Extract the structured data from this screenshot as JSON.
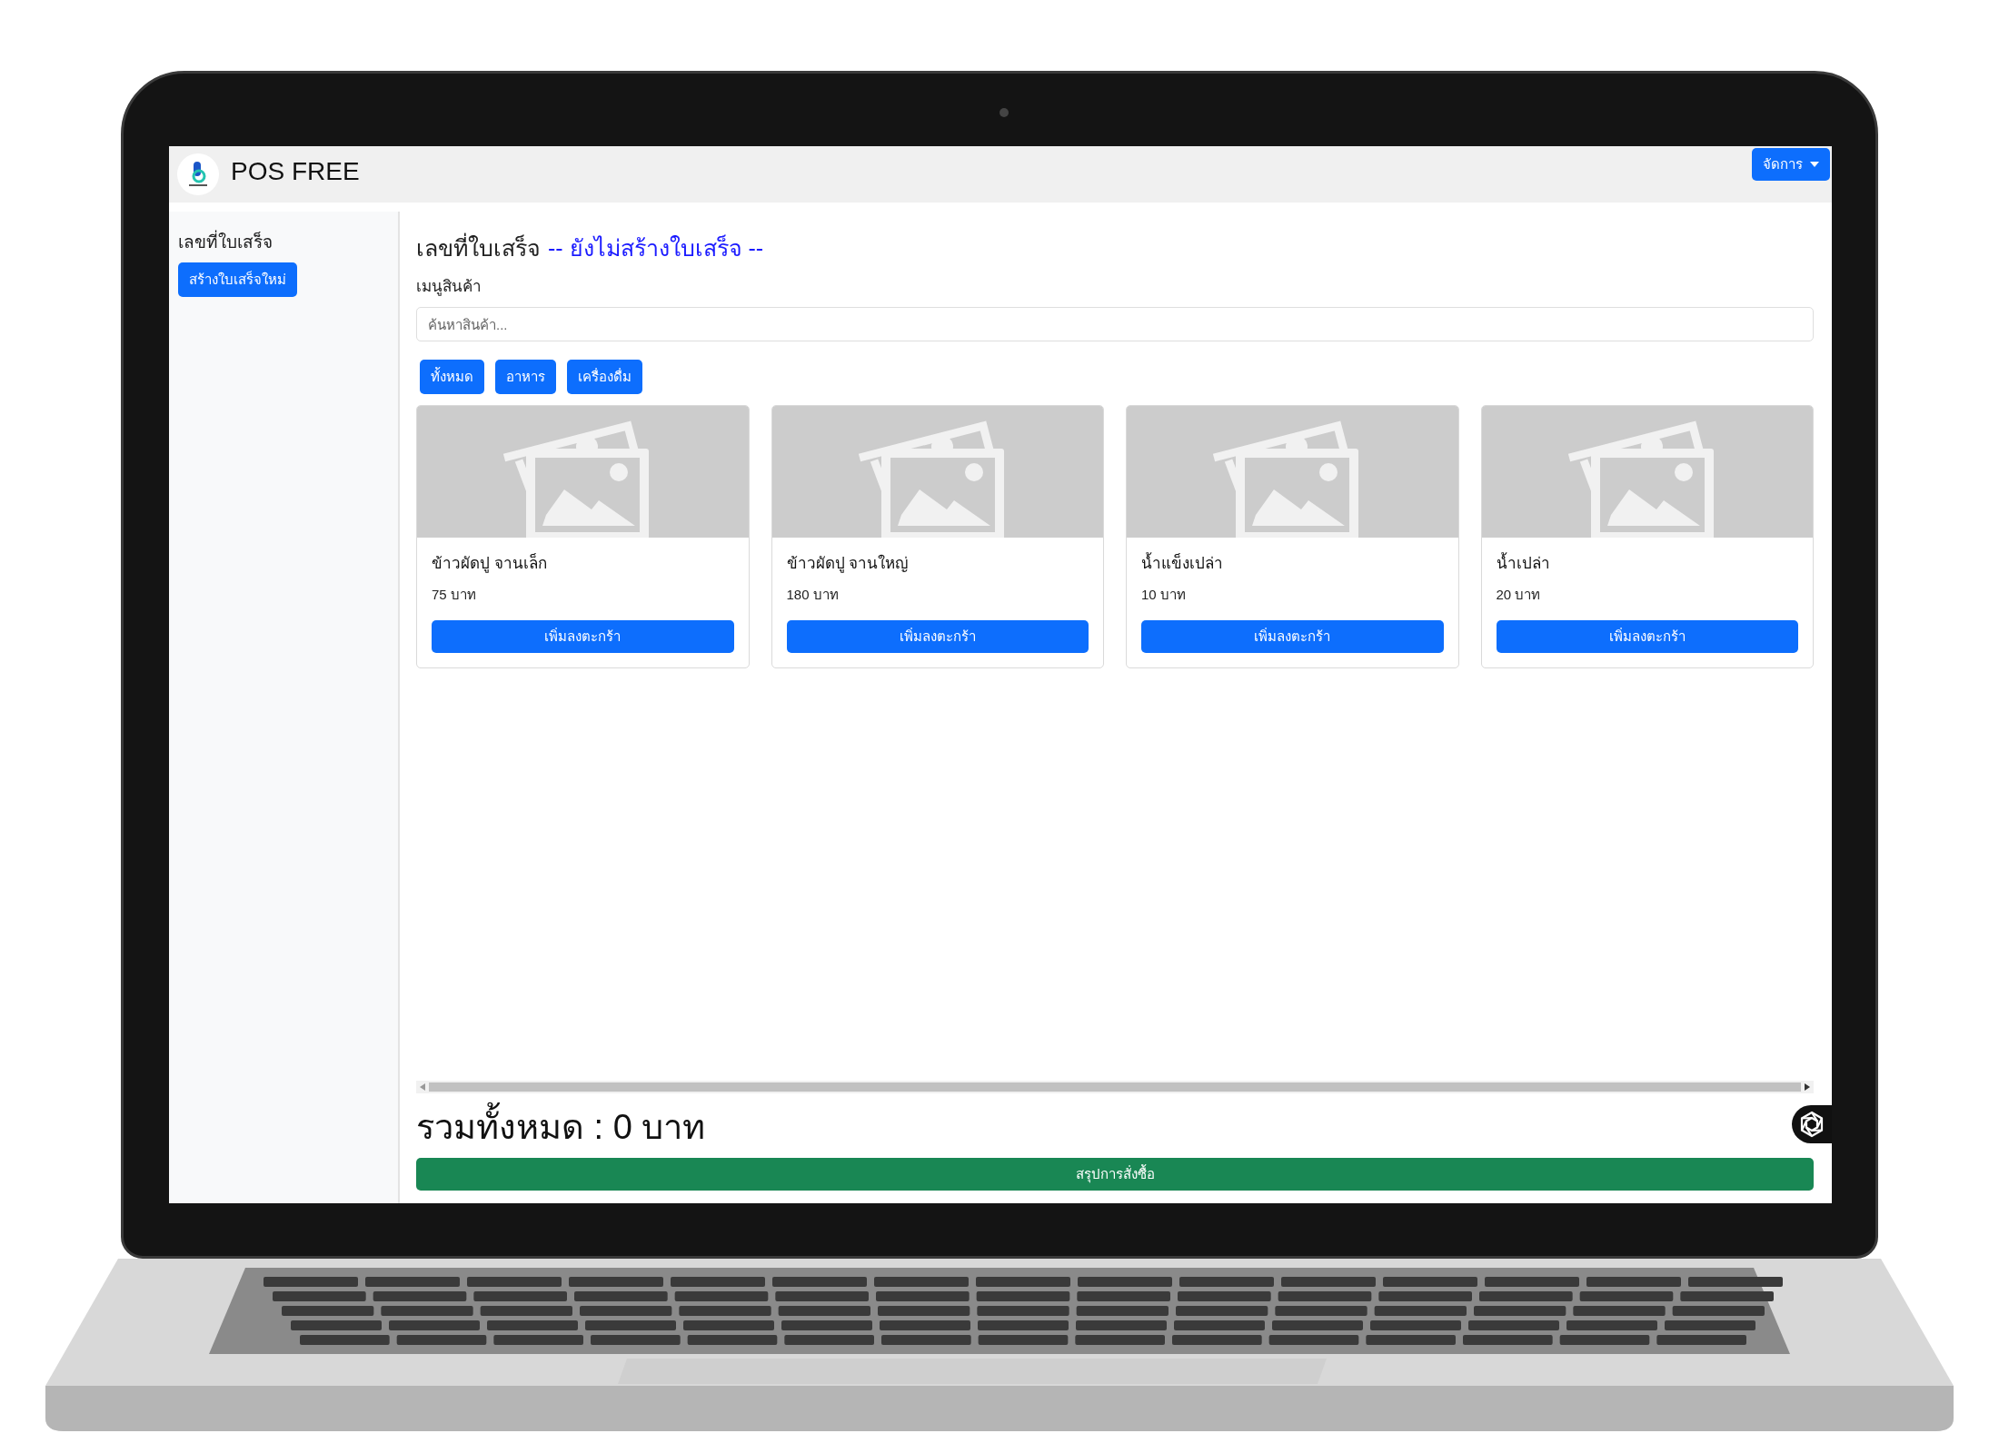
{
  "header": {
    "title": "POS FREE",
    "menu_button": "จัดการ"
  },
  "sidebar": {
    "label": "เลขที่ใบเสร็จ",
    "button": "สร้างใบเสร็จใหม่"
  },
  "receipt": {
    "label": "เลขที่ใบเสร็จ",
    "status": "-- ยังไม่สร้างใบเสร็จ --"
  },
  "menu_label": "เมนูสินค้า",
  "search": {
    "placeholder": "ค้นหาสินค้า..."
  },
  "categories": [
    {
      "label": "ทั้งหมด"
    },
    {
      "label": "อาหาร"
    },
    {
      "label": "เครื่องดื่ม"
    }
  ],
  "products": [
    {
      "name": "ข้าวผัดปู จานเล็ก",
      "price": "75 บาท",
      "button": "เพิ่มลงตะกร้า"
    },
    {
      "name": "ข้าวผัดปู จานใหญ่",
      "price": "180 บาท",
      "button": "เพิ่มลงตะกร้า"
    },
    {
      "name": "น้ำแข็งเปล่า",
      "price": "10 บาท",
      "button": "เพิ่มลงตะกร้า"
    },
    {
      "name": "น้ำเปล่า",
      "price": "20 บาท",
      "button": "เพิ่มลงตะกร้า"
    }
  ],
  "total": "รวมทั้งหมด : 0 บาท",
  "summary_button": "สรุปการสั่งซื้อ"
}
